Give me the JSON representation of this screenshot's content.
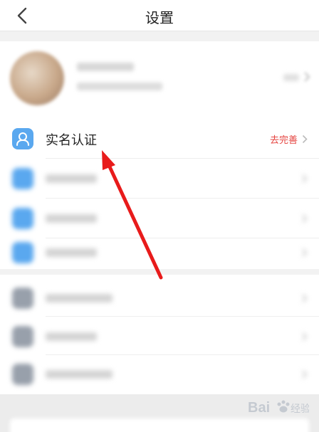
{
  "header": {
    "title": "设置"
  },
  "real_name_row": {
    "label": "实名认证",
    "action": "去完善"
  },
  "colors": {
    "accent_red": "#e5433f",
    "arrow_red": "#e81b1b",
    "icon_blue": "#5aa8ef",
    "icon_gray": "#98a0ab"
  },
  "watermark": {
    "brand": "Bai",
    "suffix": "经验"
  }
}
